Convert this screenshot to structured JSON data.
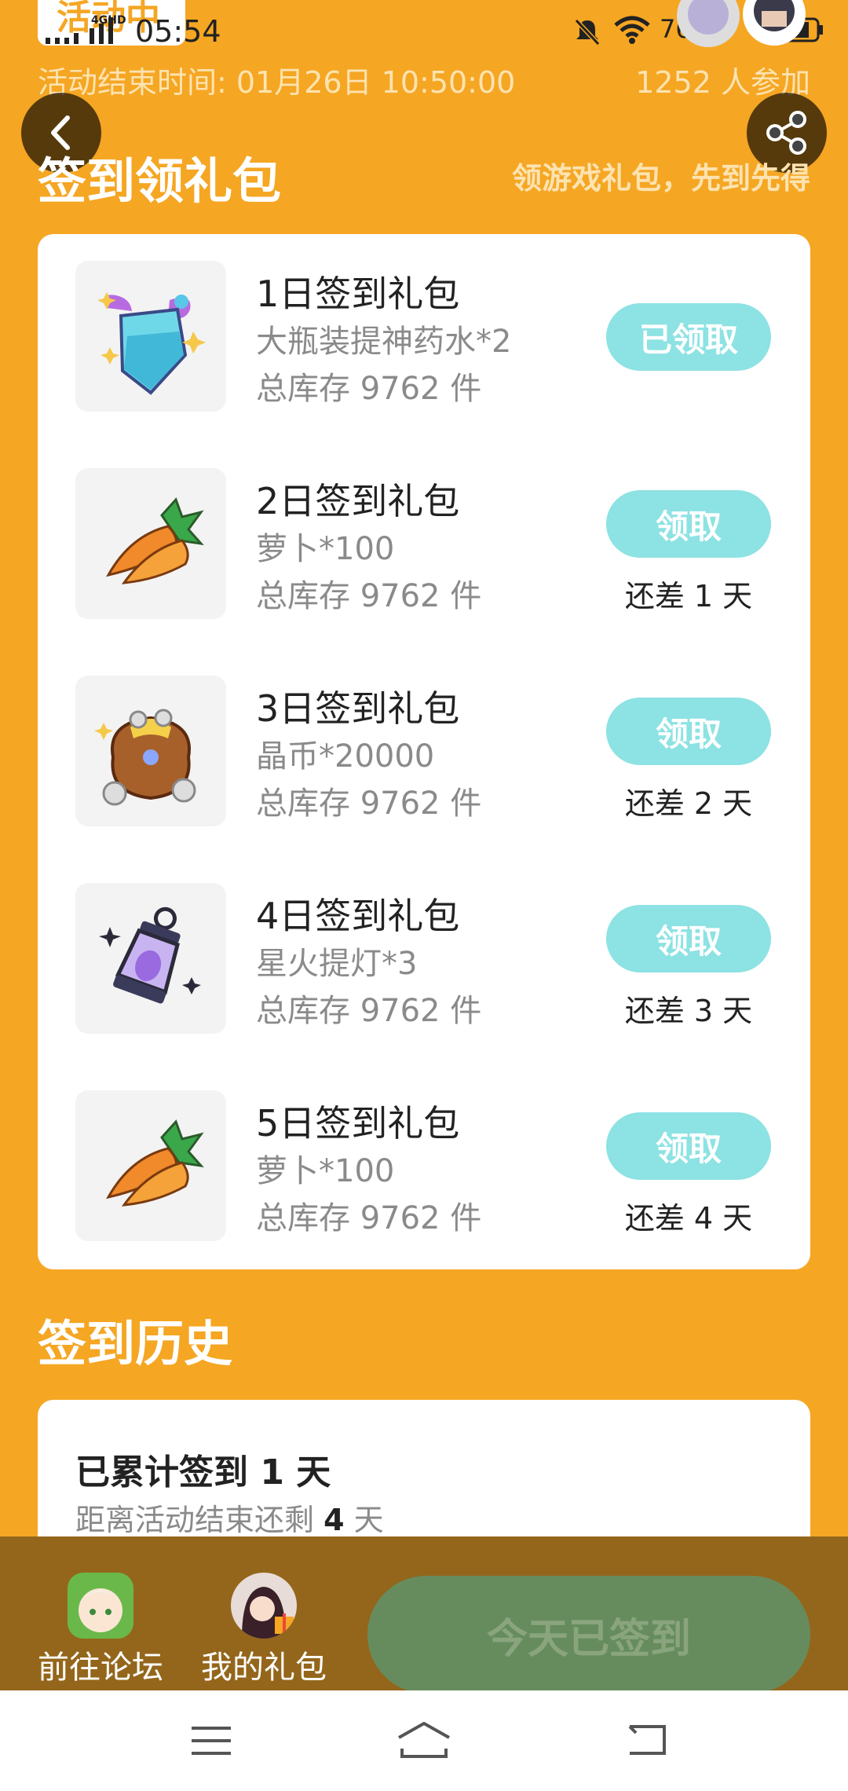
{
  "status_bar": {
    "activity_tag": "活动中",
    "network": "4GHD",
    "time": "05:54",
    "battery": "76"
  },
  "header": {
    "end_time": "活动结束时间: 01月26日 10:50:00",
    "participants": "1252 人参加"
  },
  "signin_section": {
    "title": "签到领礼包",
    "slogan": "领游戏礼包，先到先得"
  },
  "gifts": [
    {
      "title": "1日签到礼包",
      "item": "大瓶装提神药水*2",
      "stock": "总库存 9762 件",
      "button": "已领取",
      "remain": "",
      "icon": "potion-icon"
    },
    {
      "title": "2日签到礼包",
      "item": "萝卜*100",
      "stock": "总库存 9762 件",
      "button": "领取",
      "remain": "还差 1 天",
      "icon": "carrot-icon"
    },
    {
      "title": "3日签到礼包",
      "item": "晶币*20000",
      "stock": "总库存 9762 件",
      "button": "领取",
      "remain": "还差 2 天",
      "icon": "coin-bag-icon"
    },
    {
      "title": "4日签到礼包",
      "item": "星火提灯*3",
      "stock": "总库存 9762 件",
      "button": "领取",
      "remain": "还差 3 天",
      "icon": "lantern-icon"
    },
    {
      "title": "5日签到礼包",
      "item": "萝卜*100",
      "stock": "总库存 9762 件",
      "button": "领取",
      "remain": "还差 4 天",
      "icon": "carrot-icon"
    }
  ],
  "history": {
    "title": "签到历史",
    "total_label": "已累计签到 1 天",
    "remain_prefix": "距离活动结束还剩",
    "remain_days": "4",
    "remain_suffix": "天"
  },
  "bottom_bar": {
    "forum_label": "前往论坛",
    "mygift_label": "我的礼包",
    "signin_button": "今天已签到"
  },
  "colors": {
    "background": "#f5a623",
    "claim_button": "#8de2e3",
    "signed_button": "#668c5e"
  }
}
